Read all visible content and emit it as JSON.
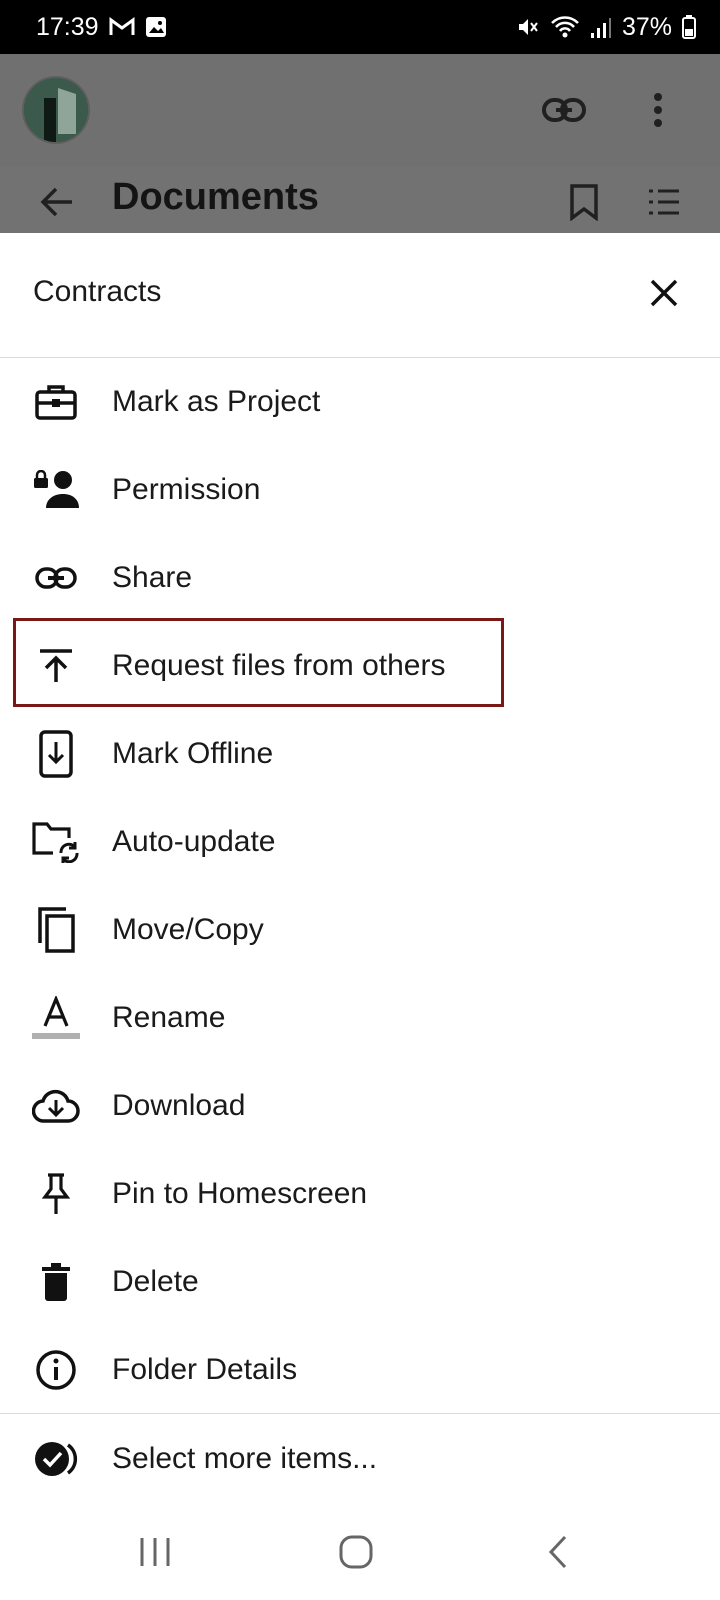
{
  "status_bar": {
    "time": "17:39",
    "left_icons": [
      "gmail-icon",
      "gallery-icon"
    ],
    "right_icons": [
      "mute-icon",
      "wifi-icon",
      "signal-icon",
      "battery-icon"
    ],
    "battery": "37%"
  },
  "app_bar": {
    "avatar": "avatar",
    "actions": [
      "link-icon",
      "more-vert-icon"
    ]
  },
  "folder_bar": {
    "title": "Documents",
    "actions": [
      "back-arrow-icon",
      "bookmark-icon",
      "sort-list-icon"
    ]
  },
  "sheet": {
    "title": "Contracts",
    "items": [
      {
        "label": "Mark as Project",
        "icon": "briefcase-icon"
      },
      {
        "label": "Permission",
        "icon": "person-lock-icon"
      },
      {
        "label": "Share",
        "icon": "link-icon"
      },
      {
        "label": "Request files from others",
        "icon": "upload-icon",
        "highlighted": true
      },
      {
        "label": "Mark Offline",
        "icon": "phone-download-icon"
      },
      {
        "label": "Auto-update",
        "icon": "folder-sync-icon"
      },
      {
        "label": "Move/Copy",
        "icon": "copy-icon"
      },
      {
        "label": "Rename",
        "icon": "rename-icon"
      },
      {
        "label": "Download",
        "icon": "cloud-download-icon"
      },
      {
        "label": "Pin to Homescreen",
        "icon": "pin-icon"
      },
      {
        "label": "Delete",
        "icon": "trash-icon"
      },
      {
        "label": "Folder Details",
        "icon": "info-icon"
      }
    ],
    "select_more": {
      "label": "Select more items...",
      "icon": "check-circle-icon"
    }
  },
  "colors": {
    "highlight_border": "#7a1717",
    "dim_overlay": "#707070"
  }
}
